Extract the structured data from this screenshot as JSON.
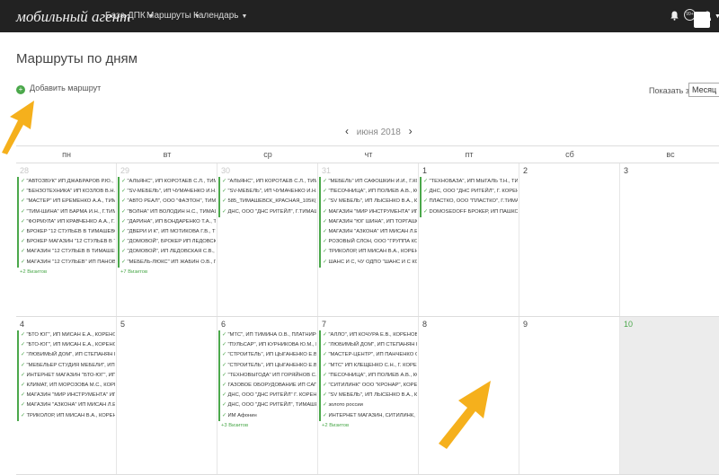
{
  "app": {
    "brand": "мобильный агент",
    "nav": [
      {
        "label": "База ДПК"
      },
      {
        "label": "Маршруты"
      },
      {
        "label": "Календарь"
      }
    ],
    "notifications_badge": "99+"
  },
  "page": {
    "title": "Маршруты по дням",
    "add_route_label": "Добавить маршрут",
    "show_for_label": "Показать за",
    "period_value": "Месяц",
    "month_label": "июня 2018"
  },
  "weekdays": [
    "пн",
    "вт",
    "ср",
    "чт",
    "пт",
    "сб",
    "вс"
  ],
  "weeks": [
    {
      "days": [
        {
          "num": "28",
          "state": "prev",
          "routes": [
            "\"АВТОЗВУК\" ИП ДЖАБРАРОВ Р.Ю., Г.ТИМАШЕВСК",
            "\"БЕНЗОТЕХНИКА\" ИП КОЗЛОВ В.Н., Г.Т",
            "\"МАСТЕР\" ИП ЕРЕМЕНКО А.А., ТИМАШ",
            "\"ТИМ-ШИНА\" ИП БАРМА И.Н., Г.ТИМА",
            "\"ФОРМУЛА\" ИП КРАВЧЕНКО А.А., Г.ТИМ",
            "БРОКЕР \"12 СТУЛЬЕВ В ТИМАШЕВСКЕ",
            "БРОКЕР МАГАЗИН \"12 СТУЛЬЕВ В ТИМ",
            "МАГАЗИН \"12 СТУЛЬЕВ В ТИМАШЕВСК",
            "МАГАЗИН \"12 СТУЛЬЕВ\" ИП ПАНОВ М."
          ],
          "more": "+2 Визитов"
        },
        {
          "num": "29",
          "state": "prev",
          "routes": [
            "\"АЛЬЯНС\", ИП КОРОТАЕВ С.Л., ТИМАШЕВСК",
            "\"SV-МЕБЕЛЬ\", ИП ЧУМАЧЕНКО И.Н., ТИМ",
            "\"АВТО РЕАЛ\", ООО \"ФАЭТОН\", ТИМАШ",
            "\"ВОЛНА\" ИП ВОЛОДИН Н.С., ТИМАШЕВ",
            "\"ДАРИНА\", ИП БОНДАРЕНКО Т.А., ТИМ",
            "\"ДВЕРИ И К\", ИП МОТИКОВА Г.В., ТИМ",
            "\"ДОМОВОЙ\", БРОКЕР ИП ЛЕДОВСКАЯ",
            "\"ДОМОВОЙ\", ИП ЛЕДОВСКАЯ С.В., ТИМ",
            "\"МЕБЕЛЬ-ЛЮКС\" ИП ЖАБИН О.В., Г. Т"
          ],
          "more": "+7 Визитов"
        },
        {
          "num": "30",
          "state": "prev",
          "routes": [
            "\"АЛЬЯНС\", ИП КОРОТАЕВ С.Л., ТИМАШЕВСК",
            "\"SV-МЕБЕЛЬ\", ИП ЧУМАЧЕНКО И.Н., ТИМ",
            "585_ТИМАШЕВСК_КРАСНАЯ_105К(Б",
            "ДНС, ООО \"ДНС РИТЕЙЛ\", Г.ТИМАШЕВСК"
          ],
          "more": ""
        },
        {
          "num": "31",
          "state": "prev",
          "routes": [
            "\"МЕБЕЛЬ\" ИП САФОШКИН И.И., Г.КОРЕНОВСК",
            "\"ПЕСОЧНИЦА\", ИП ПОЛИЕВ А.В., КОРЕНОВСК",
            "\"SV МЕБЕЛЬ\", ИП ЛЫСЕНКО В.А., КОРЕН",
            "МАГАЗИН \"МИР ИНСТРУМЕНТА\" ИП В",
            "МАГАЗИН \"ЮГ ШИНА\", ИП ТОРГАШОВ",
            "МАГАЗИН \"АЗКОНА\" ИП МИСАН Л.Е., Г",
            "РОЗОВЫЙ СЛОН, ООО \"ГРУППА КОМП",
            "ТРИКОЛОР, ИП МИСАН В.А., КОРЕНОВ",
            "ШАНС И С, ЧУ ОДПО \"ШАНС И С КОРЕН"
          ],
          "more": ""
        },
        {
          "num": "1",
          "state": "cur",
          "routes": [
            "\"ТЕХНОБАЗА\", ИП МЫГАЛЬ Т.Н., ТИМАШЕВСК",
            "ДНС, ООО \"ДНС РИТЕЙЛ\", Г. КОРЕНОВСК",
            "ПЛАСТКО, ООО \"ПЛАСТКО\", Г.ТИМАШЕВСК",
            "DOMOSEDOFF БРОКЕР, ИП ПАШКОВА"
          ],
          "more": ""
        },
        {
          "num": "2",
          "state": "cur",
          "routes": [],
          "more": ""
        },
        {
          "num": "3",
          "state": "cur",
          "routes": [],
          "more": ""
        }
      ]
    },
    {
      "days": [
        {
          "num": "4",
          "state": "cur",
          "routes": [
            "\"БТО ЮГ\", ИП МИСАН Е.А., КОРЕНОВСК",
            "\"БТО-ЮГ\", ИП МИСАН Е.А., КОРЕНОВСК",
            "\"ЛЮБИМЫЙ ДОМ\", ИП СТЕПАНЯН Р.Н.",
            "\"МЕБЕЛЬЕР СТУДИЯ МЕБЕЛИ\", ИП ЗДО",
            "ИНТЕРНЕТ МАГАЗИН \"БТО-ЮГ\", ИП МИ",
            "КЛИМАТ, ИП МОРОЗОВА М.С., КОРЕНОВ",
            "МАГАЗИН \"МИР ИНСТРУМЕНТА\" ИП В",
            "МАГАЗИН \"АЗКОНА\" ИП МИСАН Л.Е., Г",
            "ТРИКОЛОР, ИП МИСАН В.А., КОРЕНОВ"
          ],
          "more": ""
        },
        {
          "num": "5",
          "state": "cur",
          "routes": [],
          "more": ""
        },
        {
          "num": "6",
          "state": "cur",
          "routes": [
            "\"МТС\", ИП ТИМИНА О.В., ПЛАТНИРОВСКАЯ",
            "\"ПУЛЬСАР\", ИП КУРНИКОВА Ю.М., Г.К",
            "\"СТРОИТЕЛЬ\", ИП ЦЫГАНЕНКО Е.В., К",
            "\"СТРОИТЕЛЬ\", ИП ЦЫГАНЕНКО Е.В., С",
            "\"ТЕХНОВЫГОДА\" ИП ГОРЯЙНОВ С.В.",
            "ГАЗОВОЕ ОБОРУДОВАНИЕ ИП САПОЖ",
            "ДНС, ООО \"ДНС РИТЕЙЛ\" Г. КОРЕНОВ",
            "ДНС, ООО \"ДНС РИТЕЙЛ\", ТИМАШЕВСК",
            "ИМ Афонин"
          ],
          "more": "+3 Визитов"
        },
        {
          "num": "7",
          "state": "cur",
          "routes": [
            "\"АЛЛО\", ИП КОЧУРА Е.В., КОРЕНОВСК",
            "\"ЛЮБИМЫЙ ДОМ\", ИП СТЕПАНЯН Р.Н.",
            "\"МАСТЕР-ЦЕНТР\", ИП ПАНЧЕНКО О.И.",
            "\"МТС\" ИП КЛЕЩЕНКО С.Н., Г. КОРЕНОВСК",
            "\"ПЕСОЧНИЦА\", ИП ПОЛИЕВ А.В., КОРЕН",
            "\"СИТИЛИНК\" ООО \"КРОНАР\", КОРЕНОВ",
            "\"SV МЕБЕЛЬ\", ИП ЛЫСЕНКО В.А., КОРЕ",
            "золото россии",
            "ИНТЕРНЕТ МАГАЗИН, СИТИЛИНК, КРЕ"
          ],
          "more": "+2 Визитов"
        },
        {
          "num": "8",
          "state": "cur",
          "routes": [],
          "more": ""
        },
        {
          "num": "9",
          "state": "cur",
          "routes": [],
          "more": ""
        },
        {
          "num": "10",
          "state": "today",
          "routes": [],
          "more": ""
        }
      ]
    }
  ],
  "colors": {
    "accent": "#4ba84b",
    "topbar": "#222222",
    "arrow": "#f5b01c"
  },
  "icons": [
    "bell-icon",
    "user-icon",
    "plus-circle-icon",
    "chevron-left-icon",
    "chevron-right-icon"
  ]
}
